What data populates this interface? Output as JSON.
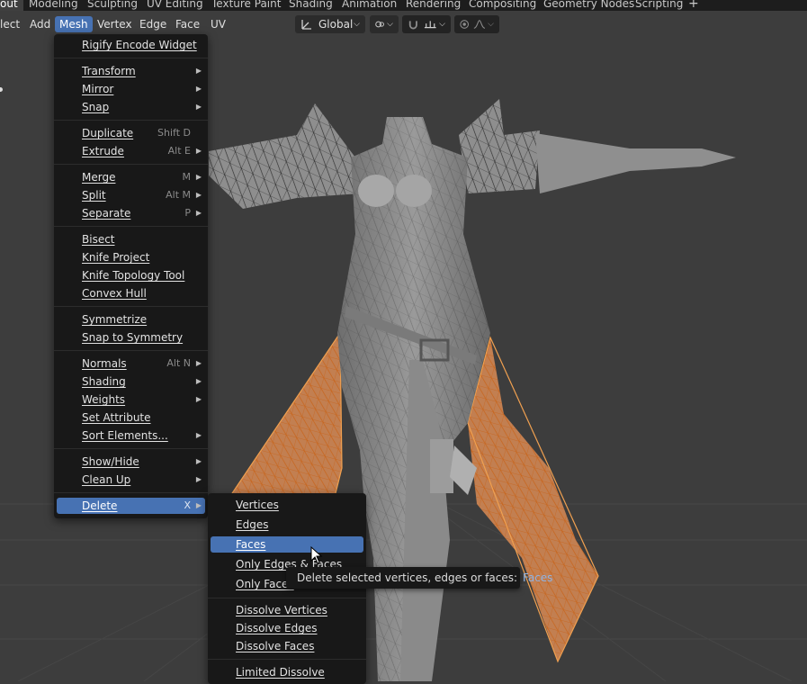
{
  "workspaces": {
    "tabs": [
      "out",
      "Modeling",
      "Sculpting",
      "UV Editing",
      "Texture Paint",
      "Shading",
      "Animation",
      "Rendering",
      "Compositing",
      "Geometry Nodes",
      "Scripting"
    ],
    "add_icon": "plus-icon"
  },
  "header": {
    "menus": [
      "lect",
      "Add",
      "Mesh",
      "Vertex",
      "Edge",
      "Face",
      "UV"
    ],
    "active_menu": "Mesh",
    "transform_orientation": "Global"
  },
  "mesh_menu": {
    "items": [
      {
        "label": "Rigify Encode Widget",
        "shortcut": "",
        "submenu": false
      },
      {
        "label": "Transform",
        "shortcut": "",
        "submenu": true
      },
      {
        "label": "Mirror",
        "shortcut": "",
        "submenu": true
      },
      {
        "label": "Snap",
        "shortcut": "",
        "submenu": true
      },
      {
        "label": "Duplicate",
        "shortcut": "Shift D",
        "submenu": false
      },
      {
        "label": "Extrude",
        "shortcut": "Alt E",
        "submenu": true
      },
      {
        "label": "Merge",
        "shortcut": "M",
        "submenu": true
      },
      {
        "label": "Split",
        "shortcut": "Alt M",
        "submenu": true
      },
      {
        "label": "Separate",
        "shortcut": "P",
        "submenu": true
      },
      {
        "label": "Bisect",
        "shortcut": "",
        "submenu": false
      },
      {
        "label": "Knife Project",
        "shortcut": "",
        "submenu": false
      },
      {
        "label": "Knife Topology Tool",
        "shortcut": "",
        "submenu": false
      },
      {
        "label": "Convex Hull",
        "shortcut": "",
        "submenu": false
      },
      {
        "label": "Symmetrize",
        "shortcut": "",
        "submenu": false
      },
      {
        "label": "Snap to Symmetry",
        "shortcut": "",
        "submenu": false
      },
      {
        "label": "Normals",
        "shortcut": "Alt N",
        "submenu": true
      },
      {
        "label": "Shading",
        "shortcut": "",
        "submenu": true
      },
      {
        "label": "Weights",
        "shortcut": "",
        "submenu": true
      },
      {
        "label": "Set Attribute",
        "shortcut": "",
        "submenu": false
      },
      {
        "label": "Sort Elements...",
        "shortcut": "",
        "submenu": true
      },
      {
        "label": "Show/Hide",
        "shortcut": "",
        "submenu": true
      },
      {
        "label": "Clean Up",
        "shortcut": "",
        "submenu": true
      },
      {
        "label": "Delete",
        "shortcut": "X",
        "submenu": true
      }
    ],
    "active_item": "Delete"
  },
  "delete_menu": {
    "items": [
      "Vertices",
      "Edges",
      "Faces",
      "Only Edges & Faces",
      "Only Faces",
      "Dissolve Vertices",
      "Dissolve Edges",
      "Dissolve Faces",
      "Limited Dissolve"
    ],
    "active_item": "Faces"
  },
  "tooltip": {
    "text": "Delete selected vertices, edges or faces:",
    "value": "Faces"
  },
  "colors": {
    "accent": "#4772b3",
    "menu_bg": "#181818",
    "viewport_bg": "#3d3d3d",
    "selection": "#e8883a",
    "tooltip_value": "#8fb3e3"
  }
}
